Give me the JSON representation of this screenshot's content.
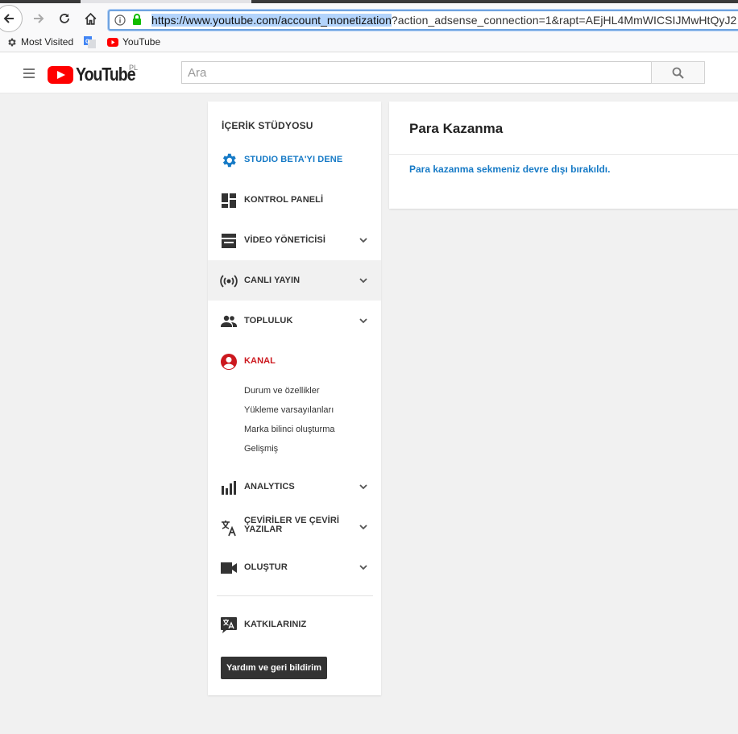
{
  "browser": {
    "url_selected": "https://www.youtube.com/account_monetization",
    "url_rest": "?action_adsense_connection=1&rapt=AEjHL4MmWICSIJMwHtQyJ2",
    "bookmarks": [
      {
        "label": "Most Visited",
        "icon": "gear-icon"
      },
      {
        "label": "",
        "icon": "google-translate-icon"
      },
      {
        "label": "YouTube",
        "icon": "youtube-icon"
      }
    ]
  },
  "masthead": {
    "logo_text": "YouTube",
    "country_code": "PL",
    "search_placeholder": "Ara"
  },
  "sidebar": {
    "title": "İÇERİK STÜDYOSU",
    "items": [
      {
        "label": "STUDIO BETA'YI DENE",
        "icon": "gear-icon"
      },
      {
        "label": "KONTROL PANELİ",
        "icon": "dashboard-icon"
      },
      {
        "label": "VİDEO YÖNETİCİSİ",
        "icon": "video-manager-icon"
      },
      {
        "label": "CANLI YAYIN",
        "icon": "live-broadcast-icon"
      },
      {
        "label": "TOPLULUK",
        "icon": "community-icon"
      },
      {
        "label": "KANAL",
        "icon": "channel-icon"
      },
      {
        "label": "ANALYTICS",
        "icon": "analytics-icon"
      },
      {
        "label": "ÇEVİRİLER VE ÇEVİRİ YAZILAR",
        "icon": "translate-icon"
      },
      {
        "label": "OLUŞTUR",
        "icon": "video-camera-icon"
      },
      {
        "label": "KATKILARINIZ",
        "icon": "contributions-icon"
      }
    ],
    "channel_subitems": [
      "Durum ve özellikler",
      "Yükleme varsayılanları",
      "Marka bilinci oluşturma",
      "Gelişmiş"
    ],
    "help_button": "Yardım ve geri bildirim"
  },
  "main": {
    "title": "Para Kazanma",
    "message": "Para kazanma sekmeniz devre dışı bırakıldı."
  },
  "colors": {
    "accent_blue": "#167ac6",
    "active_red": "#cc181e",
    "youtube_red": "#ff0000"
  }
}
